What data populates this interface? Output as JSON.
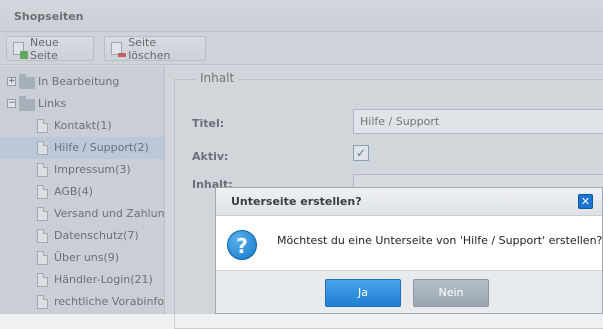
{
  "window": {
    "title": "Shopseiten"
  },
  "toolbar": {
    "new_page": "Neue Seite",
    "delete_page": "Seite löschen"
  },
  "tree": {
    "folders": [
      {
        "label": "In Bearbeitung",
        "expander": "+"
      },
      {
        "label": "Links",
        "expander": "−"
      }
    ],
    "items": [
      {
        "label": "Kontakt(1)"
      },
      {
        "label": "Hilfe / Support(2)"
      },
      {
        "label": "Impressum(3)"
      },
      {
        "label": "AGB(4)"
      },
      {
        "label": "Versand und Zahlungs"
      },
      {
        "label": "Datenschutz(7)"
      },
      {
        "label": "Über uns(9)"
      },
      {
        "label": "Händler-Login(21)"
      },
      {
        "label": "rechtliche Vorabinform"
      }
    ]
  },
  "form": {
    "legend": "Inhalt",
    "title_label": "Titel:",
    "title_value": "Hilfe / Support",
    "active_label": "Aktiv:",
    "content_label": "Inhalt:"
  },
  "dialog": {
    "title": "Unterseite erstellen?",
    "message": "Möchtest du eine Unterseite von 'Hilfe / Support' erstellen?",
    "yes": "Ja",
    "no": "Nein"
  }
}
